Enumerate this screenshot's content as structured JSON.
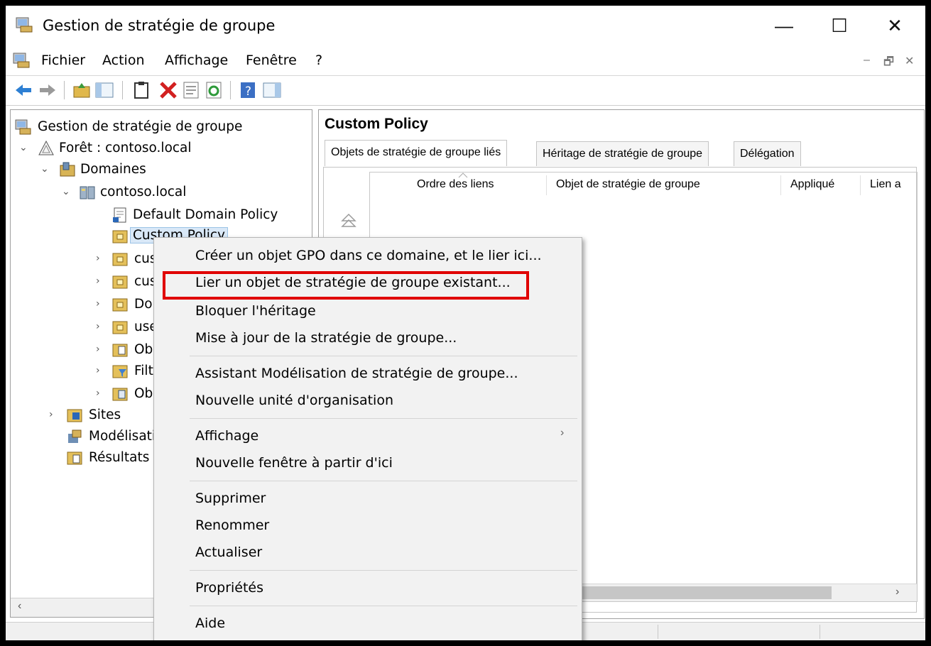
{
  "window": {
    "title": "Gestion de stratégie de groupe",
    "controls": {
      "minimize": "—",
      "maximize": "☐",
      "close": "✕"
    }
  },
  "menubar": {
    "items": [
      "Fichier",
      "Action",
      "Affichage",
      "Fenêtre",
      "?"
    ],
    "mdi_controls": {
      "minimize": "–",
      "restore": "🗗",
      "close": "✕"
    }
  },
  "toolbar": {
    "icons": [
      "back-arrow-icon",
      "forward-arrow-icon",
      "up-folder-icon",
      "show-hide-tree-icon",
      "clipboard-icon",
      "delete-icon",
      "properties-icon",
      "refresh-icon",
      "help-icon",
      "action-pane-icon"
    ]
  },
  "tree": {
    "root": "Gestion de stratégie de groupe",
    "forest": "Forêt : contoso.local",
    "domains": "Domaines",
    "domain": "contoso.local",
    "default_policy": "Default Domain Policy",
    "custom_policy": "Custom Policy",
    "children_truncated": [
      "cus",
      "cus",
      "Do",
      "use",
      "Ob",
      "Filt",
      "Ob"
    ],
    "sites": "Sites",
    "modeling": "Modélisati",
    "results": "Résultats d"
  },
  "right_pane": {
    "title": "Custom Policy",
    "tabs": [
      "Objets de stratégie de groupe liés",
      "Héritage de stratégie de groupe",
      "Délégation"
    ],
    "columns": [
      "Ordre des liens",
      "Objet de stratégie de groupe",
      "Appliqué",
      "Lien a"
    ]
  },
  "context_menu": {
    "items": [
      "Créer un objet GPO dans ce domaine, et le lier ici...",
      "Lier un objet de stratégie de groupe existant...",
      "Bloquer l'héritage",
      "Mise à jour de la stratégie de groupe...",
      "Assistant Modélisation de stratégie de groupe...",
      "Nouvelle unité d'organisation",
      "Affichage",
      "Nouvelle fenêtre à partir d'ici",
      "Supprimer",
      "Renommer",
      "Actualiser",
      "Propriétés",
      "Aide"
    ],
    "submenu_arrow": "›",
    "highlight_color": "#e00000"
  },
  "scroll": {
    "left_arrow": "‹",
    "right_arrow": "›"
  }
}
